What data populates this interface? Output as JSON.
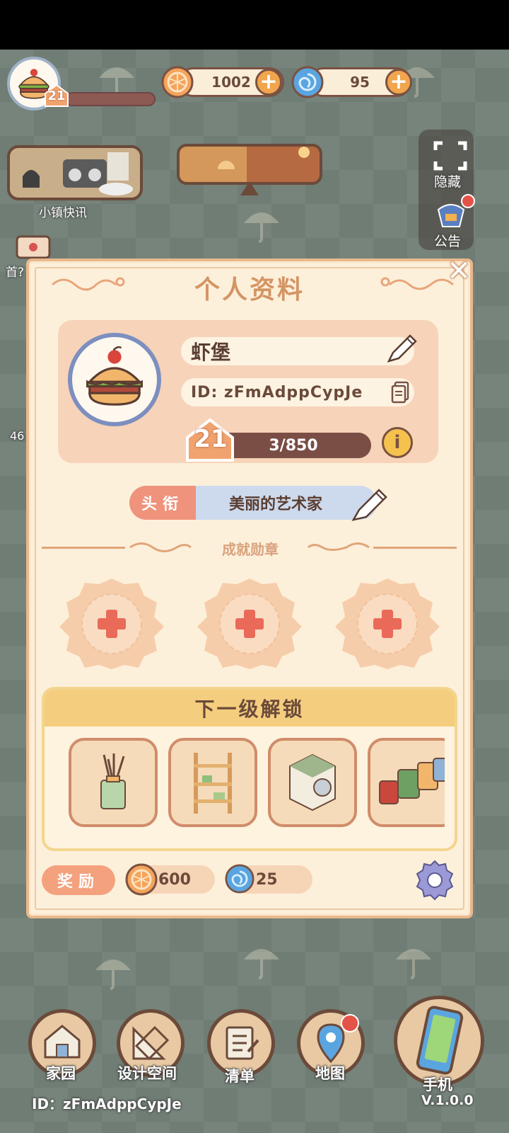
{
  "hud": {
    "level": "21",
    "coins": "1002",
    "gems": "95",
    "news_label": "小镇快讯",
    "hide_label": "隐藏",
    "notice_label": "公告",
    "side_left_label": "首?",
    "side_left_count": "46"
  },
  "profile": {
    "title": "个人资料",
    "name": "虾堡",
    "id": "ID: zFmAdppCypJe",
    "level": "21",
    "xp": "3/850",
    "info_icon": "i",
    "title_tag_label": "头衔",
    "title_tag_value": "美丽的艺术家",
    "achievements_label": "成就勋章",
    "unlock_heading": "下一级解锁",
    "unlock_items": [
      "reed-diffuser-icon",
      "wooden-shelf-icon",
      "washing-machine-icon",
      "spice-jars-icon"
    ],
    "reward_label": "奖励",
    "reward_coins": "600",
    "reward_gems": "25"
  },
  "nav": {
    "home": "家园",
    "design": "设计空间",
    "list": "清单",
    "map": "地图",
    "phone": "手机"
  },
  "footer": {
    "id": "ID：zFmAdppCypJe",
    "version": "V.1.0.0"
  },
  "colors": {
    "accent": "#f1a54d",
    "modal_bg": "#fdf0db",
    "title": "#d49564",
    "tag_label": "#ef937c",
    "red_plus": "#ea6a5a"
  }
}
